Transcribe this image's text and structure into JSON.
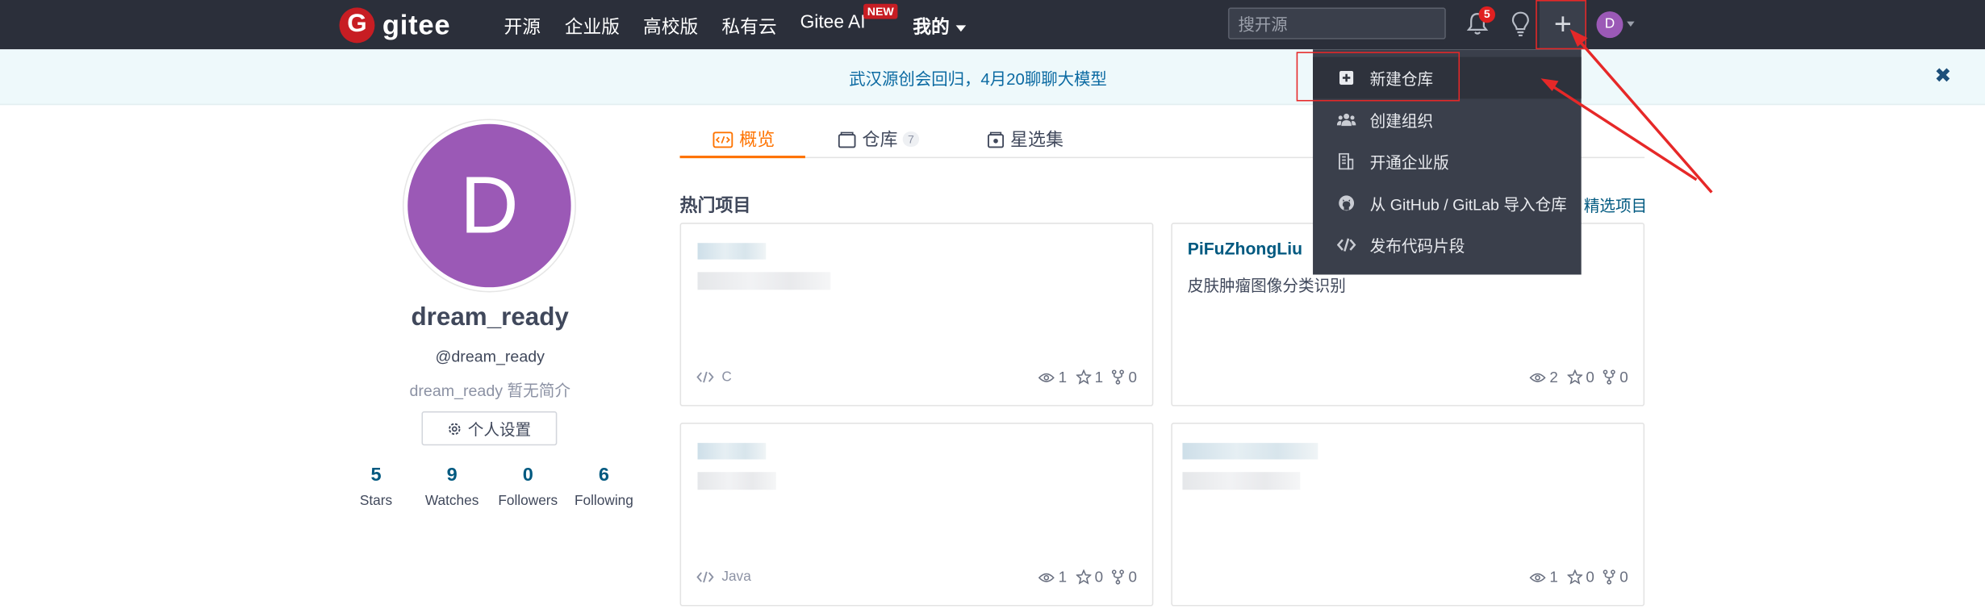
{
  "nav": {
    "logo_text": "gitee",
    "logo_badge": "G",
    "links": [
      "开源",
      "企业版",
      "高校版",
      "私有云",
      "Gitee AI"
    ],
    "new_badge": "NEW",
    "mine_label": "我的",
    "search_placeholder": "搜开源",
    "notification_count": "5",
    "plus_symbol": "+",
    "avatar_letter": "D"
  },
  "banner": {
    "text": "武汉源创会回归，4月20聊聊大模型",
    "close": "✖"
  },
  "profile": {
    "avatar_letter": "D",
    "name": "dream_ready",
    "handle": "@dream_ready",
    "bio": "dream_ready 暂无简介",
    "settings_label": "个人设置",
    "stats": [
      {
        "value": "5",
        "label": "Stars"
      },
      {
        "value": "9",
        "label": "Watches"
      },
      {
        "value": "0",
        "label": "Followers"
      },
      {
        "value": "6",
        "label": "Following"
      }
    ]
  },
  "tabs": [
    {
      "label": "概览",
      "active": true
    },
    {
      "label": "仓库",
      "count": "7"
    },
    {
      "label": "星选集"
    }
  ],
  "section": {
    "title": "热门项目",
    "featured_link": "精选项目"
  },
  "cards": [
    {
      "name": "",
      "desc": "",
      "lang": "C",
      "watch": "1",
      "star": "1",
      "fork": "0"
    },
    {
      "name": "PiFuZhongLiu",
      "desc": "皮肤肿瘤图像分类识别",
      "lang": "",
      "watch": "2",
      "star": "0",
      "fork": "0"
    },
    {
      "name": "",
      "desc": "",
      "lang": "Java",
      "watch": "1",
      "star": "0",
      "fork": "0"
    },
    {
      "name": "",
      "desc": "",
      "lang": "",
      "watch": "1",
      "star": "0",
      "fork": "0"
    }
  ],
  "dropdown": {
    "items": [
      {
        "label": "新建仓库",
        "icon": "plus-square-icon"
      },
      {
        "label": "创建组织",
        "icon": "users-icon"
      },
      {
        "label": "开通企业版",
        "icon": "building-icon"
      },
      {
        "label": "从 GitHub / GitLab 导入仓库",
        "icon": "github-icon"
      },
      {
        "label": "发布代码片段",
        "icon": "code-icon"
      }
    ]
  },
  "colors": {
    "nav_bg": "#2b2f3a",
    "brand_red": "#c71d23",
    "accent_orange": "#fe7300",
    "link_blue": "#005980",
    "avatar_purple": "#9b59b6",
    "annotation_red": "#e62828"
  }
}
